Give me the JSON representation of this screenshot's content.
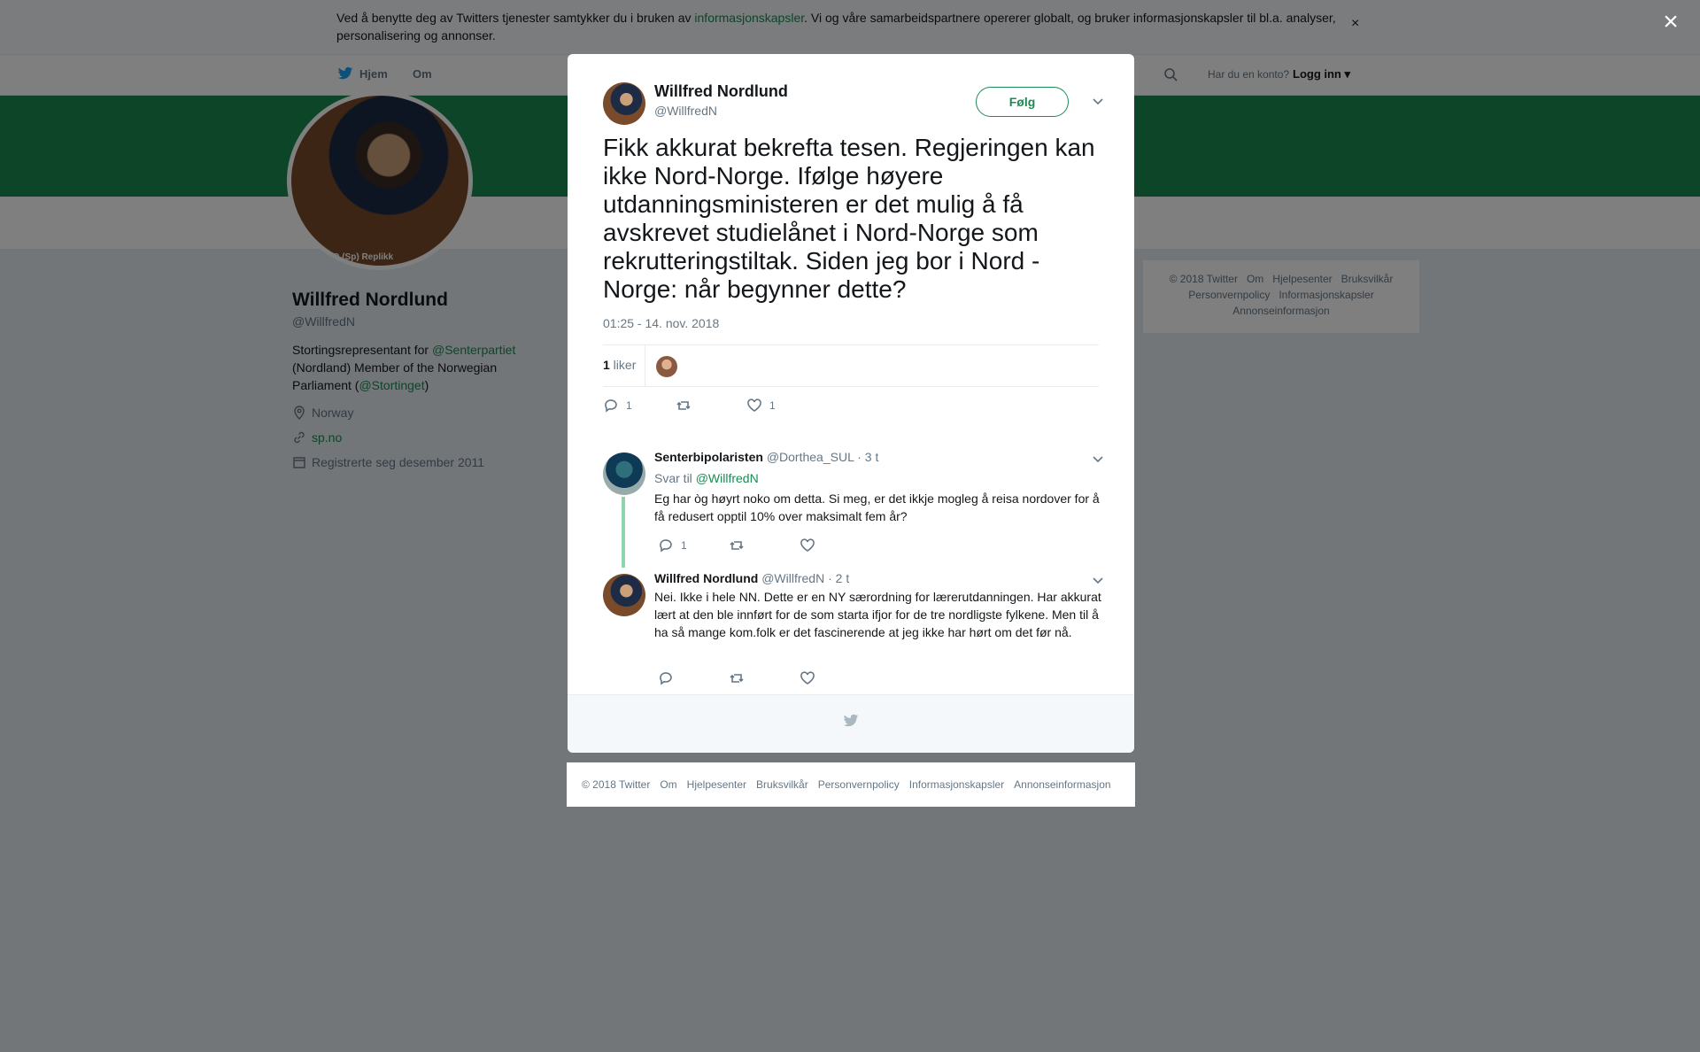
{
  "cookie": {
    "text_before": "Ved å benytte deg av Twitters tjenester samtykker du i bruken av ",
    "link": "informasjonskapsler",
    "text_after": ". Vi og våre samarbeidspartnere opererer globalt, og bruker informasjonskapsler til bl.a. analyser, personalisering og annonser.",
    "close": "×"
  },
  "nav": {
    "home": "Hjem",
    "about": "Om",
    "account_prompt": "Har du en konto?",
    "login": "Logg inn"
  },
  "profile": {
    "name": "Willfred Nordlund",
    "handle": "@WillfredN",
    "bio_1": "Stortingsrepresentant for ",
    "bio_link_1": "@Senterpartiet",
    "bio_2": " (Nordland) Member of the Norwegian Parliament (",
    "bio_link_2": "@Stortinget",
    "bio_3": ")",
    "location": "Norway",
    "website": "sp.no",
    "joined": "Registrerte seg desember 2011",
    "avatar_caption": "ND (Sp) Replikk"
  },
  "side_footer": [
    "© 2018 Twitter",
    "Om",
    "Hjelpesenter",
    "Bruksvilkår",
    "Personvernpolicy",
    "Informasjonskapsler",
    "Annonseinformasjon"
  ],
  "modal": {
    "close": "×",
    "tweet": {
      "name": "Willfred Nordlund",
      "handle": "@WillfredN",
      "follow": "Følg",
      "text": "Fikk akkurat bekrefta tesen. Regjeringen kan ikke Nord-Norge. Ifølge høyere utdanningsministeren er det mulig å få avskrevet studielånet i Nord-Norge som rekrutteringstiltak. Siden jeg bor i Nord - Norge: når begynner dette?",
      "time": "01:25 - 14. nov. 2018",
      "likes_count": "1",
      "likes_label": " liker",
      "reply_count": "1",
      "like_count": "1"
    },
    "replies": [
      {
        "name": "Senterbipolaristen",
        "handle": "@Dorthea_SUL",
        "time": "· 3 t",
        "reply_to_label": "Svar til ",
        "reply_to": "@WillfredN",
        "text": "Eg har òg høyrt noko om detta. Si meg, er det ikkje mogleg å reisa nordover for å få redusert opptil 10% over maksimalt fem år?",
        "reply_count": "1"
      },
      {
        "name": "Willfred Nordlund",
        "handle": "@WillfredN",
        "time": "· 2 t",
        "text": "Nei. Ikke i hele NN. Dette er en NY særordning for lærerutdanningen. Har akkurat lært at den ble innført for de som starta ifjor for de tre nordligste fylkene. Men til å ha så mange kom.folk er det fascinerende at jeg ikke har hørt om det før nå."
      }
    ]
  },
  "bottom_footer": [
    "© 2018 Twitter",
    "Om",
    "Hjelpesenter",
    "Bruksvilkår",
    "Personvernpolicy",
    "Informasjonskapsler",
    "Annonseinformasjon"
  ],
  "colors": {
    "brand_green": "#1a8b53",
    "muted": "#657786",
    "overlay": "rgba(0,0,0,0.5)"
  },
  "icons": [
    "twitter-bird-icon",
    "search-icon",
    "location-icon",
    "link-icon",
    "calendar-icon",
    "reply-icon",
    "retweet-icon",
    "heart-icon",
    "chevron-down-icon",
    "close-icon"
  ]
}
